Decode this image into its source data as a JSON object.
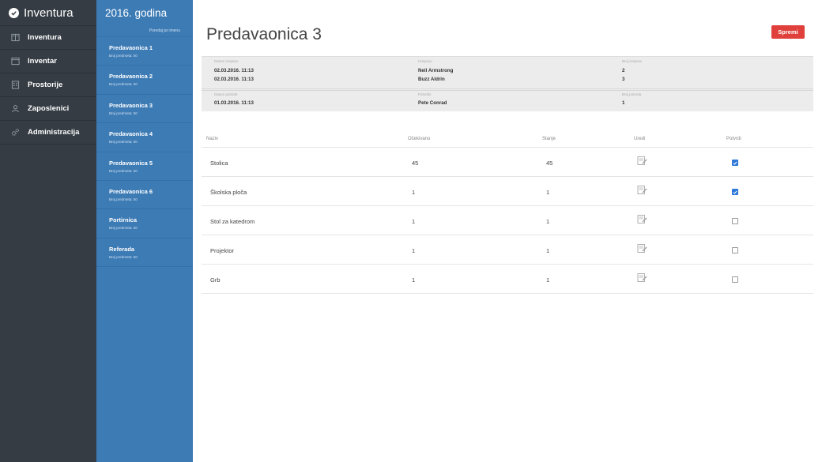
{
  "brand": {
    "title": "Inventura"
  },
  "nav": {
    "items": [
      {
        "label": "Inventura",
        "icon": "book-icon"
      },
      {
        "label": "Inventar",
        "icon": "box-icon"
      },
      {
        "label": "Prostorije",
        "icon": "building-icon"
      },
      {
        "label": "Zaposlenici",
        "icon": "user-icon"
      },
      {
        "label": "Administracija",
        "icon": "gears-icon"
      }
    ]
  },
  "rooms": {
    "title": "2016. godina",
    "sort_label": "Poredaj po imenu",
    "items": [
      {
        "name": "Predavaonica 1",
        "count": "Broj predmeta: 50"
      },
      {
        "name": "Predavaonica 2",
        "count": "Broj predmeta: 50"
      },
      {
        "name": "Predavaonica 3",
        "count": "Broj predmeta: 50"
      },
      {
        "name": "Predavaonica 4",
        "count": "Broj predmeta: 50"
      },
      {
        "name": "Predavaonica 5",
        "count": "Broj predmeta: 50"
      },
      {
        "name": "Predavaonica 6",
        "count": "Broj predmeta: 50"
      },
      {
        "name": "Portirnica",
        "count": "Broj predmeta: 50"
      },
      {
        "name": "Referada",
        "count": "Broj predmeta: 50"
      }
    ]
  },
  "main": {
    "title": "Predavaonica 3",
    "save_label": "Spremi"
  },
  "log": {
    "b1": {
      "headers": [
        "Datum izmjene",
        "Izmijenio",
        "Broj izmjena"
      ],
      "rows": [
        [
          "02.03.2016. 11:13",
          "Neil Armstrong",
          "2"
        ],
        [
          "02.03.2016. 11:13",
          "Buzz Aldrin",
          "3"
        ]
      ]
    },
    "b2": {
      "headers": [
        "Datum potvrde",
        "Potvrdio",
        "Broj potvrda"
      ],
      "rows": [
        [
          "01.03.2016. 11:13",
          "Pete Conrad",
          "1"
        ]
      ]
    }
  },
  "items": {
    "headers": [
      "Naziv",
      "Očekivano",
      "Stanje",
      "Uredi",
      "Potvrdi"
    ],
    "rows": [
      {
        "name": "Stolica",
        "expected": "45",
        "state": "45",
        "confirmed": true
      },
      {
        "name": "Školska ploča",
        "expected": "1",
        "state": "1",
        "confirmed": true
      },
      {
        "name": "Stol za katedrom",
        "expected": "1",
        "state": "1",
        "confirmed": false
      },
      {
        "name": "Projektor",
        "expected": "1",
        "state": "1",
        "confirmed": false
      },
      {
        "name": "Grb",
        "expected": "1",
        "state": "1",
        "confirmed": false
      }
    ]
  },
  "colors": {
    "nav_bg": "#353c43",
    "rooms_bg": "#3d7bb5",
    "save_btn": "#e0403b",
    "check_on": "#2e78d8"
  }
}
